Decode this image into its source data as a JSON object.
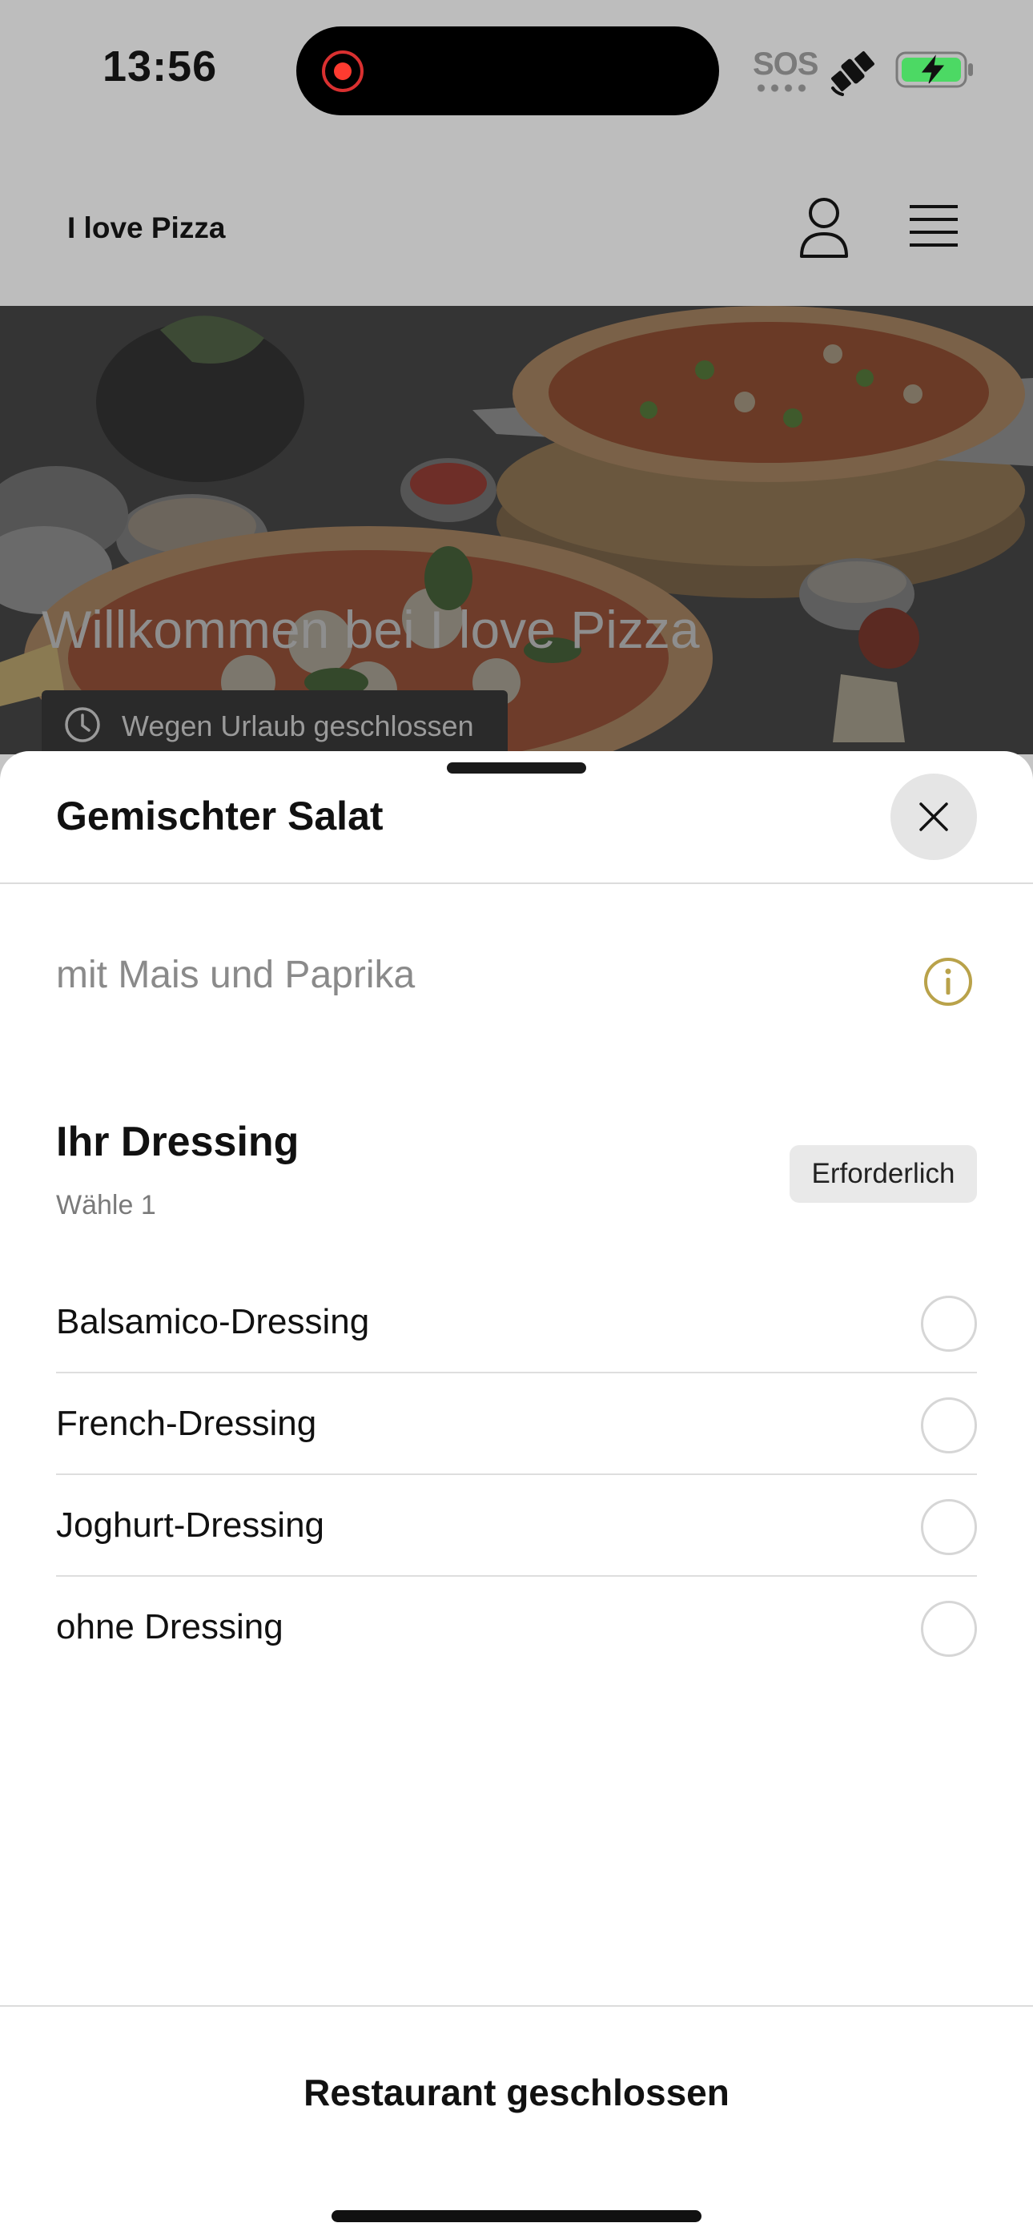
{
  "status_bar": {
    "time": "13:56",
    "sos_label": "SOS",
    "icons": [
      "screen-recording-icon",
      "satellite-icon",
      "battery-charging-icon"
    ]
  },
  "header": {
    "brand": "I love Pizza",
    "icons": [
      "user-icon",
      "hamburger-menu-icon"
    ]
  },
  "hero": {
    "title": "Willkommen bei I love Pizza",
    "status_badge": "Wegen Urlaub geschlossen",
    "status_icon": "clock-icon"
  },
  "sheet": {
    "title": "Gemischter Salat",
    "description": "mit Mais und Paprika",
    "info_icon_color": "#b9a24a",
    "group": {
      "title": "Ihr Dressing",
      "subtitle": "Wähle 1",
      "badge": "Erforderlich",
      "options": [
        {
          "label": "Balsamico-Dressing",
          "selected": false
        },
        {
          "label": "French-Dressing",
          "selected": false
        },
        {
          "label": "Joghurt-Dressing",
          "selected": false
        },
        {
          "label": "ohne Dressing",
          "selected": false
        }
      ]
    },
    "footer_label": "Restaurant geschlossen"
  }
}
